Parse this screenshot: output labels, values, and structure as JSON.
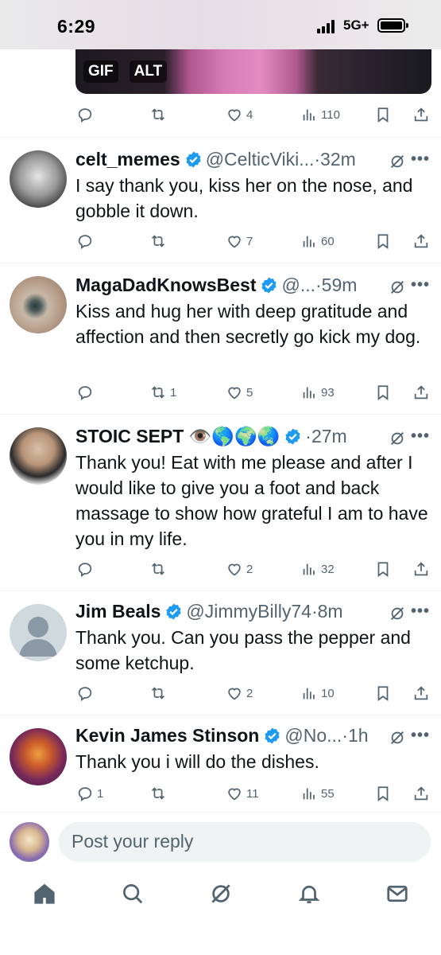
{
  "status_bar": {
    "time": "6:29",
    "network": "5G+"
  },
  "media": {
    "gif_label": "GIF",
    "alt_label": "ALT"
  },
  "top_actions": {
    "reply": "",
    "retweet": "",
    "like": "4",
    "views": "110"
  },
  "tweets": [
    {
      "name": "celt_memes",
      "handle": "@CelticViki...",
      "time": "·32m",
      "text": "I say thank you, kiss her on the nose, and gobble it down.",
      "reply_count": "",
      "retweet_count": "",
      "like_count": "7",
      "view_count": "60"
    },
    {
      "name": "MagaDadKnowsBest",
      "handle": "@...",
      "time": "·59m",
      "text": "Kiss and hug her with deep gratitude and affection and then secretly go kick my dog.",
      "reply_count": "",
      "retweet_count": "1",
      "like_count": "5",
      "view_count": "93"
    },
    {
      "name": "STOIC SEPT 👁️🌎🌍🌏",
      "handle": "",
      "time": "·27m",
      "text": "Thank you! Eat with me please and after I would like to give you a foot and back massage to show how grateful I am to have you in my life.",
      "reply_count": "",
      "retweet_count": "",
      "like_count": "2",
      "view_count": "32"
    },
    {
      "name": "Jim Beals",
      "handle": "@JimmyBilly74",
      "time": "·8m",
      "text": "Thank you. Can you pass the pepper and some ketchup.",
      "reply_count": "",
      "retweet_count": "",
      "like_count": "2",
      "view_count": "10"
    },
    {
      "name": "Kevin James Stinson",
      "handle": "@No...",
      "time": "·1h",
      "text": "Thank you i will do the dishes.",
      "reply_count": "1",
      "retweet_count": "",
      "like_count": "11",
      "view_count": "55"
    }
  ],
  "reply_bar": {
    "placeholder": "Post your reply"
  },
  "icons": {
    "nav": [
      "home-icon",
      "search-icon",
      "grok-icon",
      "notifications-icon",
      "messages-icon"
    ],
    "actions": [
      "reply-icon",
      "retweet-icon",
      "like-icon",
      "views-icon",
      "bookmark-icon",
      "share-icon"
    ]
  },
  "colors": {
    "verified": "#1d9bf0",
    "secondary_text": "#536471",
    "divider": "#eff3f4"
  }
}
